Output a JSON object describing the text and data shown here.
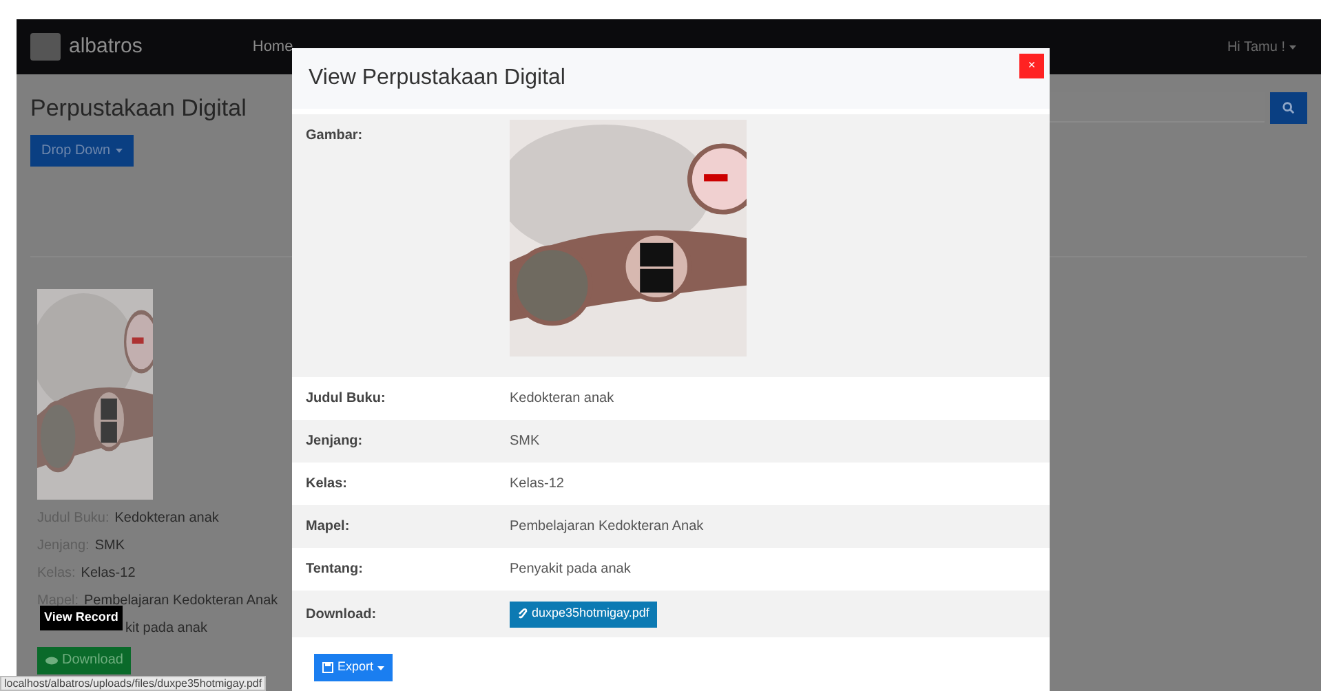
{
  "navbar": {
    "brand": "albatros",
    "menu": [
      "Home"
    ],
    "user_menu": "Hi Tamu !"
  },
  "page": {
    "title": "Perpustakaan Digital",
    "dropdown_button": "Drop Down"
  },
  "book_card": {
    "fields": [
      {
        "label": "Judul Buku:",
        "value": "Kedokteran anak"
      },
      {
        "label": "Jenjang:",
        "value": "SMK"
      },
      {
        "label": "Kelas:",
        "value": "Kelas-12"
      },
      {
        "label": "Mapel:",
        "value": "Pembelajaran Kedokteran Anak"
      },
      {
        "value": "kit pada anak"
      }
    ],
    "tooltip": "View Record",
    "download_button": "Download"
  },
  "status_bar": "localhost/albatros/uploads/files/duxpe35hotmigay.pdf",
  "modal": {
    "title": "View Perpustakaan Digital",
    "close": "×",
    "rows": [
      {
        "kind": "image",
        "label": "Gambar:"
      },
      {
        "kind": "text",
        "label": "Judul Buku:",
        "value": "Kedokteran anak"
      },
      {
        "kind": "text",
        "label": "Jenjang:",
        "value": "SMK"
      },
      {
        "kind": "text",
        "label": "Kelas:",
        "value": "Kelas-12"
      },
      {
        "kind": "text",
        "label": "Mapel:",
        "value": "Pembelajaran Kedokteran Anak"
      },
      {
        "kind": "text",
        "label": "Tentang:",
        "value": "Penyakit pada anak"
      },
      {
        "kind": "file",
        "label": "Download:",
        "value": "duxpe35hotmigay.pdf"
      }
    ],
    "export_button": "Export"
  }
}
